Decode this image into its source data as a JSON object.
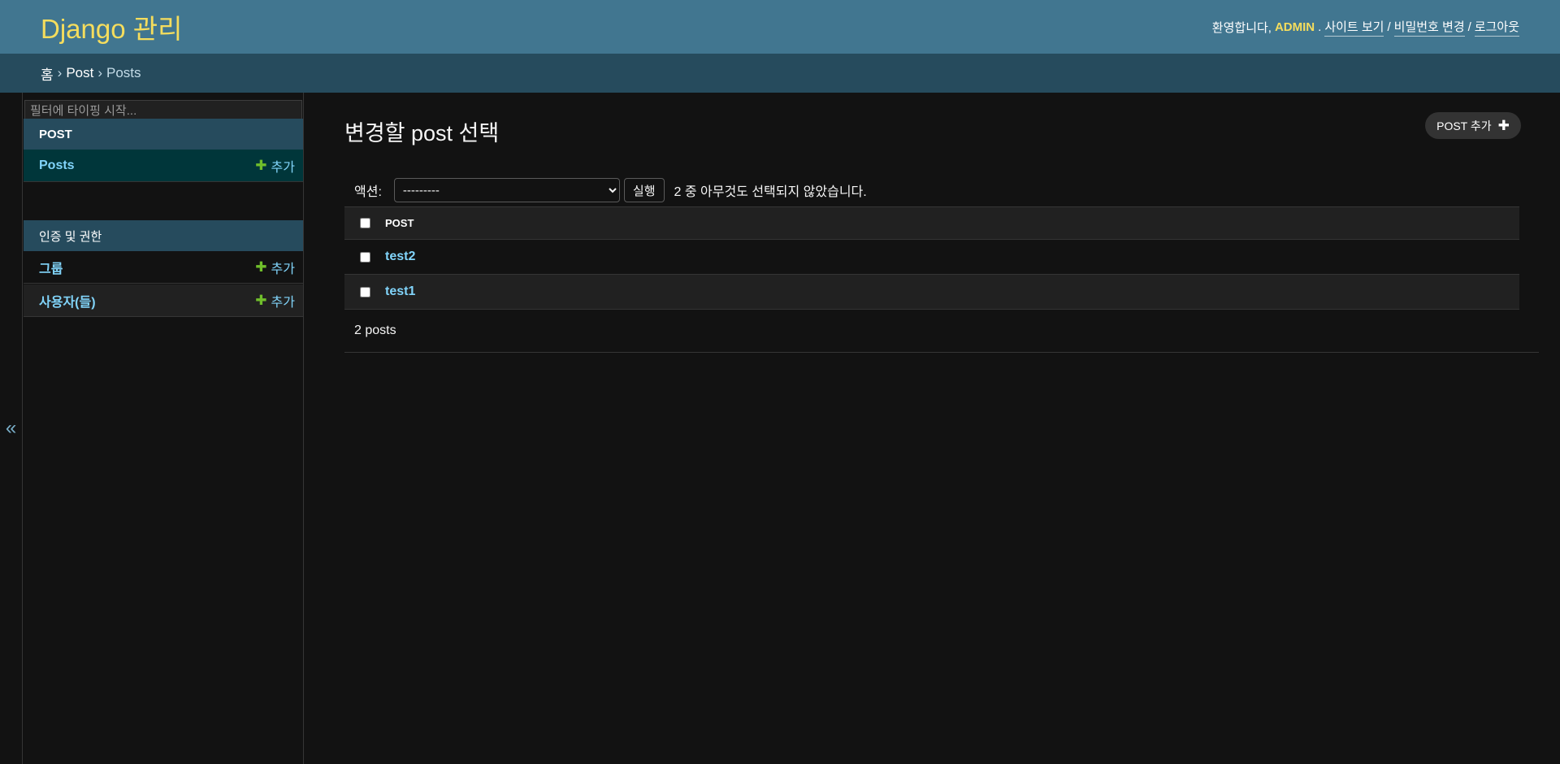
{
  "header": {
    "branding": "Django 관리",
    "welcome": "환영합니다,",
    "user_name": "ADMIN",
    "view_site": "사이트 보기",
    "change_password": "비밀번호 변경",
    "logout": "로그아웃",
    "separator": "/"
  },
  "breadcrumbs": {
    "home": "홈",
    "app": "Post",
    "current": "Posts",
    "separator": "›"
  },
  "sidebar": {
    "toggle_glyph": "«",
    "filter_placeholder": "필터에 타이핑 시작...",
    "modules": [
      {
        "caption": "POST",
        "items": [
          {
            "label": "Posts",
            "add_label": "추가"
          }
        ]
      },
      {
        "caption": "인증 및 권한",
        "items": [
          {
            "label": "그룹",
            "add_label": "추가"
          },
          {
            "label": "사용자(들)",
            "add_label": "추가"
          }
        ]
      }
    ]
  },
  "content": {
    "title": "변경할 post 선택",
    "add_button": "POST 추가",
    "actions": {
      "label": "액션:",
      "selected_option": "---------",
      "run_button": "실행",
      "counter": "2 중 아무것도 선택되지 않았습니다."
    },
    "table": {
      "column": "POST",
      "rows": [
        "test2",
        "test1"
      ]
    },
    "paginator": "2 posts"
  },
  "colors": {
    "header_bg": "#417690",
    "breadcrumbs_bg": "#264b5d",
    "accent_yellow": "#f5dd5d",
    "link_blue": "#81d4fa",
    "add_green": "#70bf2b",
    "page_bg": "#121212"
  }
}
